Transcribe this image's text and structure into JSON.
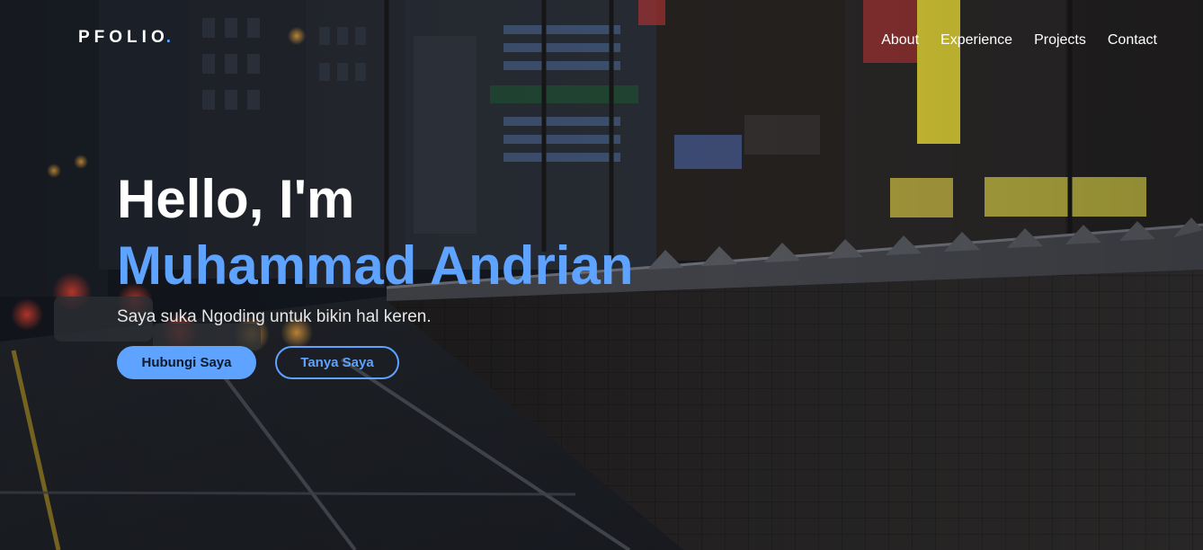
{
  "brand": {
    "logo_text": "PFOLIO",
    "logo_dot": "."
  },
  "nav": {
    "items": [
      {
        "label": "About"
      },
      {
        "label": "Experience"
      },
      {
        "label": "Projects"
      },
      {
        "label": "Contact"
      }
    ]
  },
  "hero": {
    "greeting": "Hello, I'm",
    "name": "Muhammad Andrian",
    "tagline": "Saya suka Ngoding untuk bikin hal keren.",
    "primary_button": "Hubungi Saya",
    "secondary_button": "Tanya Saya"
  },
  "colors": {
    "accent": "#5ea3ff",
    "text": "#ffffff"
  }
}
